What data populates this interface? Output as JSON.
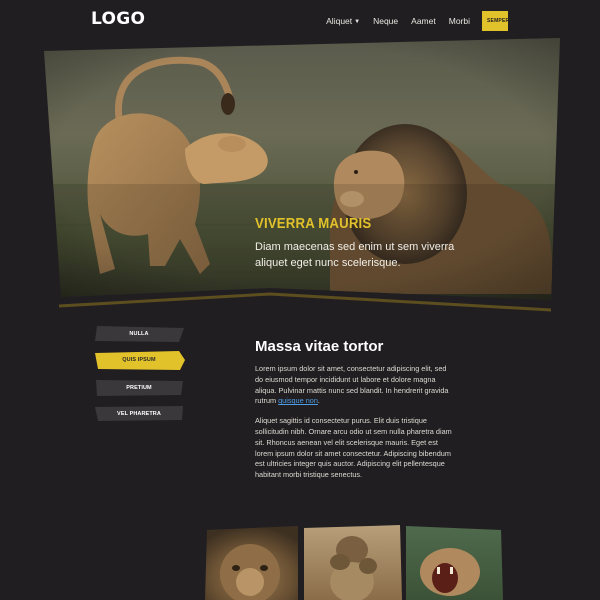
{
  "header": {
    "logo": "LOGO",
    "nav": [
      {
        "label": "Aliquet",
        "dropdown": true
      },
      {
        "label": "Neque"
      },
      {
        "label": "Aamet"
      },
      {
        "label": "Morbi"
      }
    ],
    "cta_label": "SEMPER"
  },
  "hero": {
    "title": "VIVERRA MAURIS",
    "text": "Diam maecenas sed enim ut sem viverra aliquet eget nunc scelerisque."
  },
  "side_menu": {
    "items": [
      {
        "label": "NULLA",
        "active": false
      },
      {
        "label": "QUIS IPSUM",
        "active": true
      },
      {
        "label": "PRETIUM",
        "active": false
      },
      {
        "label": "VEL PHARETRA",
        "active": false
      }
    ]
  },
  "content": {
    "title": "Massa vitae tortor",
    "p1_text": "Lorem ipsum dolor sit amet, consectetur adipiscing elit, sed do eiusmod tempor incididunt ut labore et dolore magna aliqua. Pulvinar mattis nunc sed blandit. In hendrerit gravida rutrum ",
    "p1_link": "quisque non",
    "p1_end": ".",
    "p2": "Aliquet sagittis id consectetur purus. Elit duis tristique sollicitudin nibh. Ornare arcu odio ut sem nulla pharetra diam sit. Rhoncus aenean vel elit scelerisque mauris. Eget est lorem ipsum dolor sit amet consectetur. Adipiscing bibendum est ultricies integer quis auctor. Adipiscing elit pellentesque habitant morbi tristique senectus."
  },
  "colors": {
    "background": "#211e21",
    "accent": "#e2c22b",
    "link": "#4c9ce6",
    "menu_item": "#3a383a"
  }
}
